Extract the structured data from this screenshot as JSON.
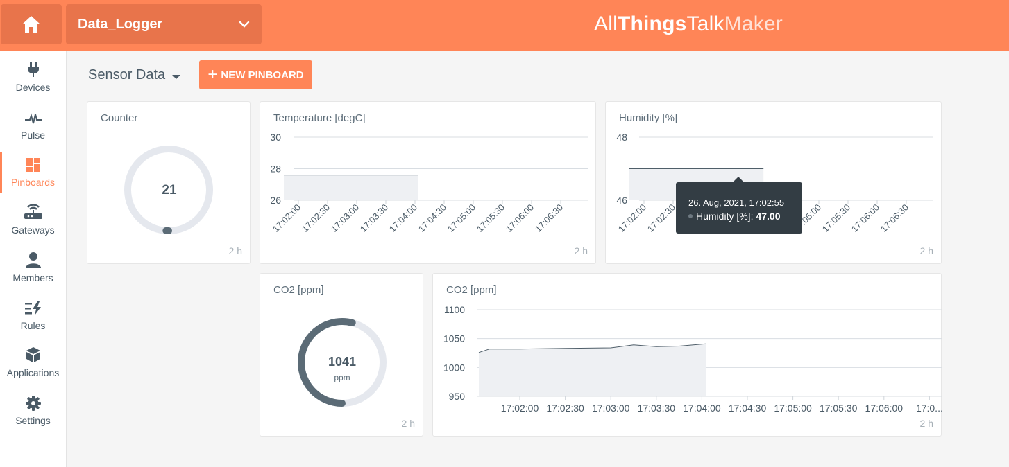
{
  "header": {
    "device_name": "Data_Logger",
    "brand": {
      "part1": "All",
      "part2": "Things",
      "part3": "Talk",
      "part4": "Maker"
    },
    "accent_color": "#ff8557",
    "dark_accent_color": "#e8744b"
  },
  "sidebar": {
    "items": [
      {
        "label": "Devices",
        "icon": "plug-icon",
        "active": false
      },
      {
        "label": "Pulse",
        "icon": "pulse-icon",
        "active": false
      },
      {
        "label": "Pinboards",
        "icon": "pinboards-icon",
        "active": true
      },
      {
        "label": "Gateways",
        "icon": "router-icon",
        "active": false
      },
      {
        "label": "Members",
        "icon": "person-icon",
        "active": false
      },
      {
        "label": "Rules",
        "icon": "rules-icon",
        "active": false
      },
      {
        "label": "Applications",
        "icon": "cube-icon",
        "active": false
      },
      {
        "label": "Settings",
        "icon": "gear-icon",
        "active": false
      }
    ]
  },
  "toolbar": {
    "pinboard_name": "Sensor Data",
    "new_pinboard_label": "NEW PINBOARD"
  },
  "cards": {
    "counter": {
      "title": "Counter",
      "value": "21",
      "footer": "2 h",
      "level": 0.01
    },
    "co2_gauge": {
      "title": "CO2 [ppm]",
      "value": "1041",
      "unit": "ppm",
      "footer": "2 h",
      "level": 0.54
    },
    "temperature": {
      "title": "Temperature [degC]",
      "footer": "2 h"
    },
    "humidity": {
      "title": "Humidity [%]",
      "footer": "2 h"
    },
    "co2_chart": {
      "title": "CO2 [ppm]",
      "footer": "2 h"
    }
  },
  "tooltip": {
    "date": "26. Aug, 2021, 17:02:55",
    "label": "Humidity [%]:",
    "value": "47.00"
  },
  "chart_data": [
    {
      "type": "area",
      "title": "Temperature [degC]",
      "y_ticks": [
        "30",
        "28",
        "26"
      ],
      "ylim": [
        26,
        30
      ],
      "x_ticks": [
        "17:02:00",
        "17:02:30",
        "17:03:00",
        "17:03:30",
        "17:04:00",
        "17:04:30",
        "17:05:00",
        "17:05:30",
        "17:06:00",
        "17:06:30"
      ],
      "series": [
        {
          "x": [
            "17:01:45",
            "17:04:03"
          ],
          "y": [
            27.6,
            27.6
          ]
        }
      ]
    },
    {
      "type": "area",
      "title": "Humidity [%]",
      "y_ticks": [
        "48",
        "46"
      ],
      "ylim": [
        46,
        48
      ],
      "x_ticks": [
        "17:02:00",
        "17:02:30",
        "17:03:00",
        "17:03:30",
        "17:04:00",
        "17:04:30",
        "17:05:00",
        "17:05:30",
        "17:06:00",
        "17:06:30"
      ],
      "series": [
        {
          "x": [
            "17:01:45",
            "17:04:03"
          ],
          "y": [
            47.0,
            47.0
          ]
        }
      ]
    },
    {
      "type": "area",
      "title": "CO2 [ppm]",
      "y_ticks": [
        "1100",
        "1050",
        "1000",
        "950"
      ],
      "ylim": [
        950,
        1100
      ],
      "x_ticks": [
        "17:02:00",
        "17:02:30",
        "17:03:00",
        "17:03:30",
        "17:04:00",
        "17:04:30",
        "17:05:00",
        "17:05:30",
        "17:06:00",
        "17:0..."
      ],
      "series": [
        {
          "x": [
            "17:01:33",
            "17:01:40",
            "17:02:00",
            "17:02:30",
            "17:03:00",
            "17:03:15",
            "17:03:30",
            "17:03:45",
            "17:04:03"
          ],
          "y": [
            1026,
            1032,
            1032,
            1033,
            1034,
            1039,
            1036,
            1037,
            1041
          ]
        }
      ]
    }
  ]
}
